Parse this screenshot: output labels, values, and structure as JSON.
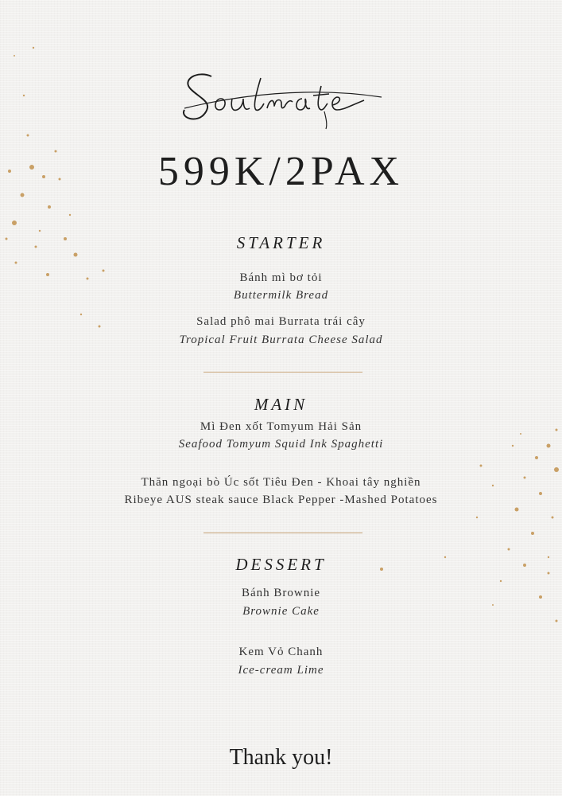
{
  "header": {
    "brand": "Soulmate",
    "price": "599K/2PAX"
  },
  "sections": [
    {
      "title": "STARTER",
      "items": [
        {
          "vn": "Bánh mì bơ tỏi",
          "en": "Buttermilk Bread"
        },
        {
          "vn": "Salad phô mai Burrata trái cây",
          "en": "Tropical Fruit Burrata Cheese Salad"
        }
      ]
    },
    {
      "title": "MAIN",
      "items": [
        {
          "vn": "Mì Đen xốt Tomyum Hải Sản",
          "en": "Seafood Tomyum Squid Ink Spaghetti"
        },
        {
          "vn": "Thăn ngoại bò Úc sốt Tiêu Đen - Khoai tây nghiền",
          "en": "Ribeye AUS steak sauce Black Pepper -Mashed Potatoes"
        }
      ]
    },
    {
      "title": "DESSERT",
      "items": [
        {
          "vn": "Bánh Brownie",
          "en": "Brownie Cake"
        },
        {
          "vn": "Kem Vỏ Chanh",
          "en": "Ice-cream Lime"
        }
      ]
    }
  ],
  "footer": {
    "thanks": "Thank you!"
  },
  "colors": {
    "background": "#f2f1ef",
    "accent_gold": "#c9a77c",
    "text": "#1e1e1e"
  }
}
